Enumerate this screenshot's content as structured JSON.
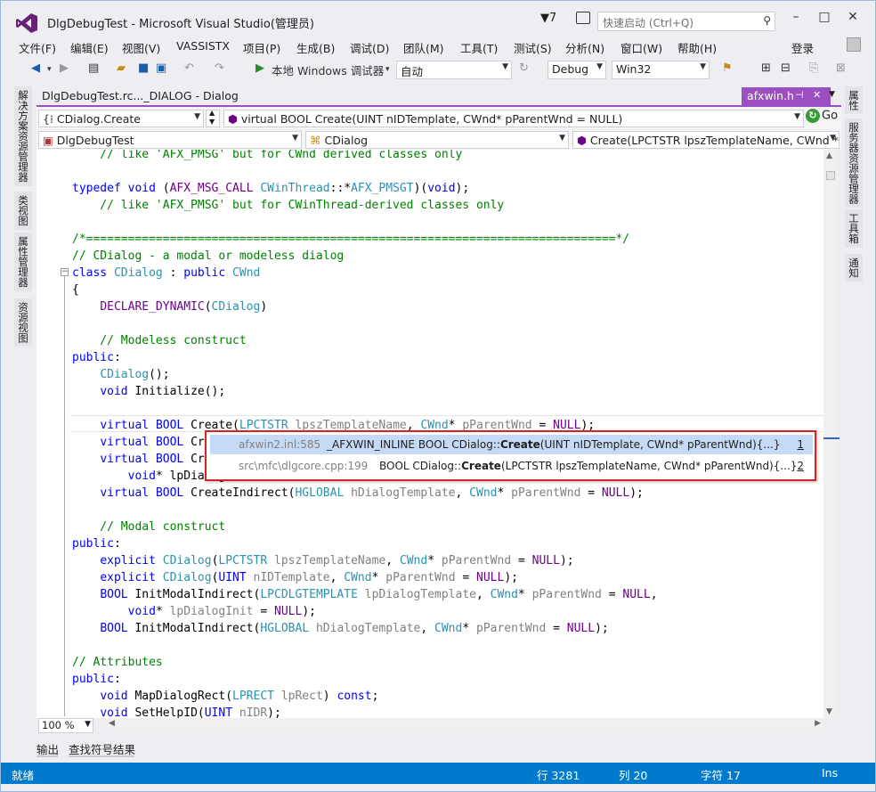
{
  "window": {
    "title": "DlgDebugTest - Microsoft Visual Studio(管理员)",
    "notification_count": "7",
    "quick_launch_placeholder": "快速启动 (Ctrl+Q)"
  },
  "menu": {
    "items": [
      "文件(F)",
      "编辑(E)",
      "视图(V)",
      "VASSISTX",
      "项目(P)",
      "生成(B)",
      "调试(D)",
      "团队(M)",
      "工具(T)",
      "测试(S)",
      "分析(N)",
      "窗口(W)",
      "帮助(H)"
    ],
    "login": "登录"
  },
  "toolbar": {
    "run_label": "本地 Windows 调试器",
    "solution_config_auto": "自动",
    "config": "Debug",
    "platform": "Win32"
  },
  "left_side_tabs": [
    "解决方案资源管理器",
    "类视图",
    "属性管理器",
    "资源视图"
  ],
  "right_side_tabs": [
    "属性",
    "服务器资源管理器",
    "工具箱",
    "通知"
  ],
  "document_tabs": {
    "main": "DlgDebugTest.rc..._DIALOG - Dialog",
    "active": "afxwin.h"
  },
  "navigation": {
    "row1_left": "CDialog.Create",
    "row1_right": "virtual BOOL Create(UINT nIDTemplate, CWnd* pParentWnd = NULL)",
    "go": "Go",
    "row2_project": "DlgDebugTest",
    "row2_class": "CDialog",
    "row2_member": "Create(LPCTSTR lpszTemplateName, CWnd *"
  },
  "code_lines": [
    [
      [
        "cm",
        "    // like 'AFX_PMSG' but for CWnd derived classes only"
      ]
    ],
    [],
    [
      [
        "kw",
        "typedef"
      ],
      [
        "tx",
        " "
      ],
      [
        "kw",
        "void"
      ],
      [
        "tx",
        " ("
      ],
      [
        "mc",
        "AFX_MSG_CALL"
      ],
      [
        "tx",
        " "
      ],
      [
        "ty",
        "CWinThread"
      ],
      [
        "tx",
        "::*"
      ],
      [
        "ty",
        "AFX_PMSGT"
      ],
      [
        "tx",
        ")("
      ],
      [
        "kw",
        "void"
      ],
      [
        "tx",
        ");"
      ]
    ],
    [
      [
        "cm",
        "    // like 'AFX_PMSG' but for CWinThread-derived classes only"
      ]
    ],
    [],
    [
      [
        "cm",
        "/*============================================================================*/"
      ]
    ],
    [
      [
        "cm",
        "// CDialog - a modal or modeless dialog"
      ]
    ],
    [
      [
        "kw",
        "class"
      ],
      [
        "tx",
        " "
      ],
      [
        "ty",
        "CDialog"
      ],
      [
        "tx",
        " : "
      ],
      [
        "kw",
        "public"
      ],
      [
        "tx",
        " "
      ],
      [
        "ty",
        "CWnd"
      ]
    ],
    [
      [
        "tx",
        "{"
      ]
    ],
    [
      [
        "tx",
        "    "
      ],
      [
        "mc",
        "DECLARE_DYNAMIC"
      ],
      [
        "tx",
        "("
      ],
      [
        "ty",
        "CDialog"
      ],
      [
        "tx",
        ")"
      ]
    ],
    [],
    [
      [
        "cm",
        "    // Modeless construct"
      ]
    ],
    [
      [
        "kw",
        "public"
      ],
      [
        "tx",
        ":"
      ]
    ],
    [
      [
        "tx",
        "    "
      ],
      [
        "ty",
        "CDialog"
      ],
      [
        "tx",
        "();"
      ]
    ],
    [
      [
        "tx",
        "    "
      ],
      [
        "kw",
        "void"
      ],
      [
        "tx",
        " Initialize();"
      ]
    ],
    [],
    [
      [
        "tx",
        "    "
      ],
      [
        "kw",
        "virtual"
      ],
      [
        "tx",
        " "
      ],
      [
        "kw",
        "BOOL"
      ],
      [
        "tx",
        " Create("
      ],
      [
        "ty",
        "LPCTSTR"
      ],
      [
        "tx",
        " "
      ],
      [
        "pa",
        "lpszTemplateName"
      ],
      [
        "tx",
        ", "
      ],
      [
        "ty",
        "CWnd"
      ],
      [
        "tx",
        "* "
      ],
      [
        "pa",
        "pParentWnd"
      ],
      [
        "tx",
        " = "
      ],
      [
        "mc",
        "NULL"
      ],
      [
        "tx",
        ");"
      ]
    ],
    [
      [
        "tx",
        "    "
      ],
      [
        "kw",
        "virtual"
      ],
      [
        "tx",
        " "
      ],
      [
        "kw",
        "BOOL"
      ],
      [
        "tx",
        " Cr"
      ]
    ],
    [
      [
        "tx",
        "    "
      ],
      [
        "kw",
        "virtual"
      ],
      [
        "tx",
        " "
      ],
      [
        "kw",
        "BOOL"
      ],
      [
        "tx",
        " Cr"
      ]
    ],
    [
      [
        "tx",
        "        "
      ],
      [
        "kw",
        "void"
      ],
      [
        "tx",
        "* lpDialogInit = NULL);"
      ]
    ],
    [
      [
        "tx",
        "    "
      ],
      [
        "kw",
        "virtual"
      ],
      [
        "tx",
        " "
      ],
      [
        "kw",
        "BOOL"
      ],
      [
        "tx",
        " CreateIndirect("
      ],
      [
        "ty",
        "HGLOBAL"
      ],
      [
        "tx",
        " "
      ],
      [
        "pa",
        "hDialogTemplate"
      ],
      [
        "tx",
        ", "
      ],
      [
        "ty",
        "CWnd"
      ],
      [
        "tx",
        "* "
      ],
      [
        "pa",
        "pParentWnd"
      ],
      [
        "tx",
        " = "
      ],
      [
        "mc",
        "NULL"
      ],
      [
        "tx",
        ");"
      ]
    ],
    [],
    [
      [
        "cm",
        "    // Modal construct"
      ]
    ],
    [
      [
        "kw",
        "public"
      ],
      [
        "tx",
        ":"
      ]
    ],
    [
      [
        "tx",
        "    "
      ],
      [
        "kw",
        "explicit"
      ],
      [
        "tx",
        " "
      ],
      [
        "ty",
        "CDialog"
      ],
      [
        "tx",
        "("
      ],
      [
        "ty",
        "LPCTSTR"
      ],
      [
        "tx",
        " "
      ],
      [
        "pa",
        "lpszTemplateName"
      ],
      [
        "tx",
        ", "
      ],
      [
        "ty",
        "CWnd"
      ],
      [
        "tx",
        "* "
      ],
      [
        "pa",
        "pParentWnd"
      ],
      [
        "tx",
        " = "
      ],
      [
        "mc",
        "NULL"
      ],
      [
        "tx",
        ");"
      ]
    ],
    [
      [
        "tx",
        "    "
      ],
      [
        "kw",
        "explicit"
      ],
      [
        "tx",
        " "
      ],
      [
        "ty",
        "CDialog"
      ],
      [
        "tx",
        "("
      ],
      [
        "kw",
        "UINT"
      ],
      [
        "tx",
        " "
      ],
      [
        "pa",
        "nIDTemplate"
      ],
      [
        "tx",
        ", "
      ],
      [
        "ty",
        "CWnd"
      ],
      [
        "tx",
        "* "
      ],
      [
        "pa",
        "pParentWnd"
      ],
      [
        "tx",
        " = "
      ],
      [
        "mc",
        "NULL"
      ],
      [
        "tx",
        ");"
      ]
    ],
    [
      [
        "tx",
        "    "
      ],
      [
        "kw",
        "BOOL"
      ],
      [
        "tx",
        " InitModalIndirect("
      ],
      [
        "ty",
        "LPCDLGTEMPLATE"
      ],
      [
        "tx",
        " "
      ],
      [
        "pa",
        "lpDialogTemplate"
      ],
      [
        "tx",
        ", "
      ],
      [
        "ty",
        "CWnd"
      ],
      [
        "tx",
        "* "
      ],
      [
        "pa",
        "pParentWnd"
      ],
      [
        "tx",
        " = "
      ],
      [
        "mc",
        "NULL"
      ],
      [
        "tx",
        ","
      ]
    ],
    [
      [
        "tx",
        "        "
      ],
      [
        "kw",
        "void"
      ],
      [
        "tx",
        "* "
      ],
      [
        "pa",
        "lpDialogInit"
      ],
      [
        "tx",
        " = "
      ],
      [
        "mc",
        "NULL"
      ],
      [
        "tx",
        ");"
      ]
    ],
    [
      [
        "tx",
        "    "
      ],
      [
        "kw",
        "BOOL"
      ],
      [
        "tx",
        " InitModalIndirect("
      ],
      [
        "ty",
        "HGLOBAL"
      ],
      [
        "tx",
        " "
      ],
      [
        "pa",
        "hDialogTemplate"
      ],
      [
        "tx",
        ", "
      ],
      [
        "ty",
        "CWnd"
      ],
      [
        "tx",
        "* "
      ],
      [
        "pa",
        "pParentWnd"
      ],
      [
        "tx",
        " = "
      ],
      [
        "mc",
        "NULL"
      ],
      [
        "tx",
        ");"
      ]
    ],
    [],
    [
      [
        "cm",
        "// Attributes"
      ]
    ],
    [
      [
        "kw",
        "public"
      ],
      [
        "tx",
        ":"
      ]
    ],
    [
      [
        "tx",
        "    "
      ],
      [
        "kw",
        "void"
      ],
      [
        "tx",
        " MapDialogRect("
      ],
      [
        "ty",
        "LPRECT"
      ],
      [
        "tx",
        " "
      ],
      [
        "pa",
        "lpRect"
      ],
      [
        "tx",
        ") "
      ],
      [
        "kw",
        "const"
      ],
      [
        "tx",
        ";"
      ]
    ],
    [
      [
        "tx",
        "    "
      ],
      [
        "kw",
        "void"
      ],
      [
        "tx",
        " SetHelpID("
      ],
      [
        "kw",
        "UINT"
      ],
      [
        "tx",
        " "
      ],
      [
        "pa",
        "nIDR"
      ],
      [
        "tx",
        ");"
      ]
    ]
  ],
  "definition_popup": [
    {
      "file": "afxwin2.inl:585",
      "pre": "_AFXWIN_INLINE BOOL CDialog::",
      "bold": "Create",
      "post": "(UINT nIDTemplate, CWnd* pParentWnd){...}",
      "num": "1",
      "selected": true
    },
    {
      "file": "src\\mfc\\dlgcore.cpp:199",
      "pre": "BOOL CDialog::",
      "bold": "Create",
      "post": "(LPCTSTR lpszTemplateName, CWnd* pParentWnd){...}",
      "num": "2",
      "selected": false
    }
  ],
  "zoom": "100 %",
  "bottom_tabs": [
    "输出",
    "查找符号结果"
  ],
  "status": {
    "ready": "就绪",
    "line": "行 3281",
    "col": "列 20",
    "char": "字符 17",
    "mode": "Ins"
  },
  "colors": {
    "accent": "#9b4fc0",
    "status_bar": "#007acc",
    "popup_border": "#d32525"
  }
}
